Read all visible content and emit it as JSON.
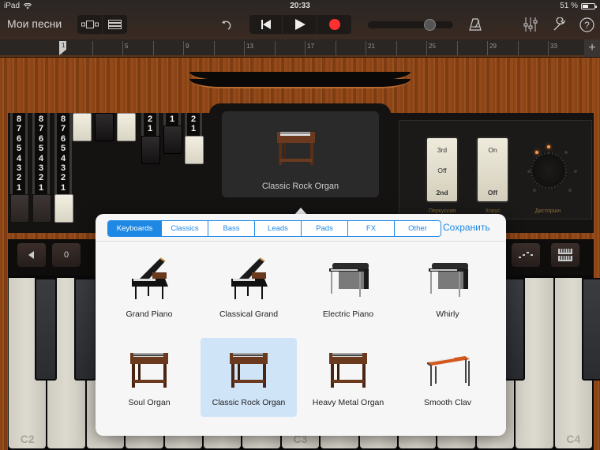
{
  "status_bar": {
    "device": "iPad",
    "time": "20:33",
    "battery": "51 %",
    "battery_level": 0.51
  },
  "toolbar": {
    "my_songs": "Мои песни",
    "view_buttons": [
      {
        "icon": "track-view-icon"
      },
      {
        "icon": "tracks-list-icon"
      }
    ],
    "undo_icon": "undo-icon",
    "transport": [
      {
        "icon": "rewind-to-start-icon"
      },
      {
        "icon": "play-icon"
      },
      {
        "icon": "record-icon"
      }
    ],
    "volume_level": 0.72,
    "right_icons": [
      "metronome-icon",
      "mixer-icon",
      "settings-wrench-icon",
      "help-icon"
    ],
    "record_color": "#ff3030"
  },
  "ruler": {
    "playhead": "1",
    "bars": [
      "5",
      "9",
      "13",
      "17",
      "21",
      "25",
      "29",
      "33"
    ],
    "add_label": "+"
  },
  "organ": {
    "drawbars": [
      {
        "numbers": [
          "8",
          "7",
          "6",
          "5",
          "4",
          "3",
          "2",
          "1"
        ],
        "cap": "dark"
      },
      {
        "numbers": [
          "8",
          "7",
          "6",
          "5",
          "4",
          "3",
          "2",
          "1"
        ],
        "cap": "dark"
      },
      {
        "numbers": [
          "8",
          "7",
          "6",
          "5",
          "4",
          "3",
          "2",
          "1"
        ],
        "cap": "white"
      },
      {
        "numbers": [],
        "cap": "white"
      },
      {
        "numbers": [],
        "cap": "black"
      },
      {
        "numbers": [],
        "cap": "white"
      },
      {
        "numbers": [
          "2",
          "1"
        ],
        "cap": "black"
      },
      {
        "numbers": [
          "1"
        ],
        "cap": "black"
      },
      {
        "numbers": [
          "2",
          "1"
        ],
        "cap": "white"
      }
    ],
    "current_instrument": "Classic Rock Organ",
    "percussion": {
      "label": "Перкуссия",
      "options": [
        "3rd",
        "Off",
        "2nd"
      ],
      "selected": "2nd"
    },
    "chorus": {
      "label": "Хорус",
      "options": [
        "On",
        "Off"
      ],
      "selected": "Off"
    },
    "distortion": {
      "label": "Дисторшн"
    }
  },
  "keyboard_controls": {
    "octave_down_icon": "octave-down-icon",
    "octave_value": "0",
    "arpeggiator_icon": "arpeggiator-icon",
    "keyboard_layout_icon": "keyboard-layout-icon"
  },
  "keyboard": {
    "labels": {
      "c2": "C2",
      "c3": "C3",
      "c4": "C4"
    }
  },
  "popover": {
    "tabs": [
      {
        "label": "Keyboards",
        "active": true
      },
      {
        "label": "Classics",
        "active": false
      },
      {
        "label": "Bass",
        "active": false
      },
      {
        "label": "Leads",
        "active": false
      },
      {
        "label": "Pads",
        "active": false
      },
      {
        "label": "FX",
        "active": false
      },
      {
        "label": "Other",
        "active": false
      }
    ],
    "save_label": "Сохранить",
    "instruments": [
      {
        "name": "Grand Piano",
        "type": "grand-piano",
        "selected": false
      },
      {
        "name": "Classical Grand",
        "type": "grand-piano",
        "selected": false
      },
      {
        "name": "Electric Piano",
        "type": "electric-piano",
        "selected": false
      },
      {
        "name": "Whirly",
        "type": "electric-piano",
        "selected": false
      },
      {
        "name": "Soul Organ",
        "type": "organ",
        "selected": false
      },
      {
        "name": "Classic Rock Organ",
        "type": "organ",
        "selected": true
      },
      {
        "name": "Heavy Metal Organ",
        "type": "organ",
        "selected": false
      },
      {
        "name": "Smooth Clav",
        "type": "clav",
        "selected": false
      }
    ]
  }
}
